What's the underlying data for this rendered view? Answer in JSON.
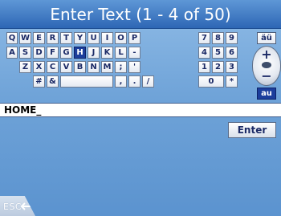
{
  "title": "Enter Text (1 - 4 of 50)",
  "keyboard": {
    "row1": [
      "Q",
      "W",
      "E",
      "R",
      "T",
      "Y",
      "U",
      "I",
      "O",
      "P"
    ],
    "row2": [
      "A",
      "S",
      "D",
      "F",
      "G",
      "H",
      "J",
      "K",
      "L",
      "-"
    ],
    "row3": [
      "Z",
      "X",
      "C",
      "V",
      "B",
      "N",
      "M",
      ";",
      "'"
    ],
    "row4": [
      "#",
      "&",
      "",
      ",",
      ".",
      "/"
    ],
    "numpad": [
      "7",
      "8",
      "9",
      "4",
      "5",
      "6",
      "1",
      "2",
      "3",
      "0",
      "*"
    ],
    "selected_key": "H"
  },
  "side": {
    "umlaut_label": "äü",
    "au_label": "au",
    "plus": "+",
    "minus": "−"
  },
  "input": {
    "value": "HOME_"
  },
  "enter_label": "Enter",
  "esc_label": "ESC"
}
